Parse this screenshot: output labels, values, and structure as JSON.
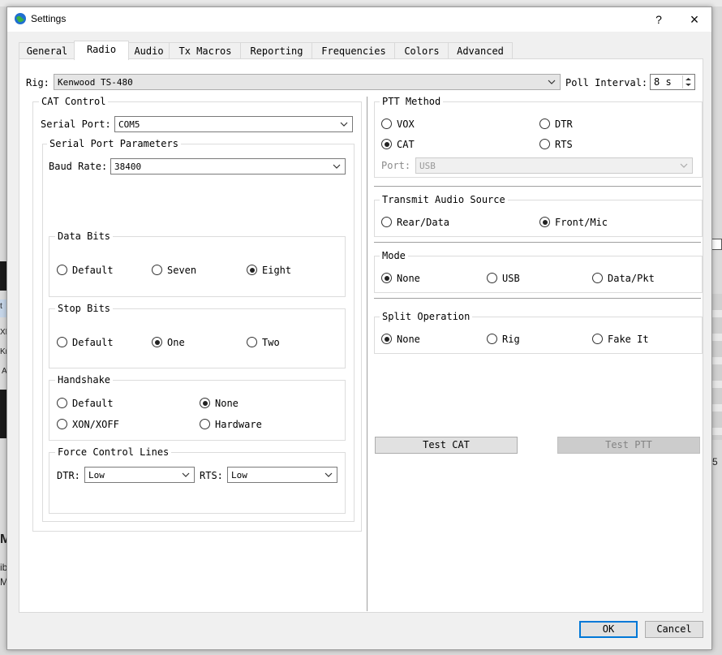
{
  "window": {
    "title": "Settings",
    "help_label": "?",
    "close_label": "×"
  },
  "tabs": [
    {
      "label": "General"
    },
    {
      "label": "Radio"
    },
    {
      "label": "Audio"
    },
    {
      "label": "Tx Macros"
    },
    {
      "label": "Reporting"
    },
    {
      "label": "Frequencies"
    },
    {
      "label": "Colors"
    },
    {
      "label": "Advanced"
    }
  ],
  "active_tab": "Radio",
  "rig": {
    "label": "Rig:",
    "value": "Kenwood TS-480"
  },
  "poll": {
    "label": "Poll Interval:",
    "value": "8 s"
  },
  "cat": {
    "title": "CAT Control",
    "serial_port": {
      "label": "Serial Port:",
      "value": "COM5"
    },
    "params_title": "Serial Port Parameters",
    "baud": {
      "label": "Baud Rate:",
      "value": "38400"
    },
    "data_bits": {
      "title": "Data Bits",
      "options": [
        "Default",
        "Seven",
        "Eight"
      ],
      "selected": "Eight"
    },
    "stop_bits": {
      "title": "Stop Bits",
      "options": [
        "Default",
        "One",
        "Two"
      ],
      "selected": "One"
    },
    "handshake": {
      "title": "Handshake",
      "options": [
        "Default",
        "None",
        "XON/XOFF",
        "Hardware"
      ],
      "selected": "None"
    },
    "force": {
      "title": "Force Control Lines",
      "dtr_label": "DTR:",
      "dtr_value": "Low",
      "rts_label": "RTS:",
      "rts_value": "Low"
    }
  },
  "ptt": {
    "title": "PTT Method",
    "options": [
      "VOX",
      "DTR",
      "CAT",
      "RTS"
    ],
    "selected": "CAT",
    "port_label": "Port:",
    "port_value": "USB"
  },
  "tx_audio": {
    "title": "Transmit Audio Source",
    "options": [
      "Rear/Data",
      "Front/Mic"
    ],
    "selected": "Front/Mic"
  },
  "mode": {
    "title": "Mode",
    "options": [
      "None",
      "USB",
      "Data/Pkt"
    ],
    "selected": "None"
  },
  "split": {
    "title": "Split Operation",
    "options": [
      "None",
      "Rig",
      "Fake It"
    ],
    "selected": "None"
  },
  "buttons": {
    "test_cat": "Test CAT",
    "test_ptt": "Test PTT",
    "ok": "OK",
    "cancel": "Cancel"
  },
  "background": {
    "frag_1": "M",
    "frag_2": "ib",
    "frag_3": "M",
    "frag_4": "5",
    "frag_5": "t",
    "frag_6": "XN",
    "frag_7": "Kn",
    "frag_8": "A"
  }
}
